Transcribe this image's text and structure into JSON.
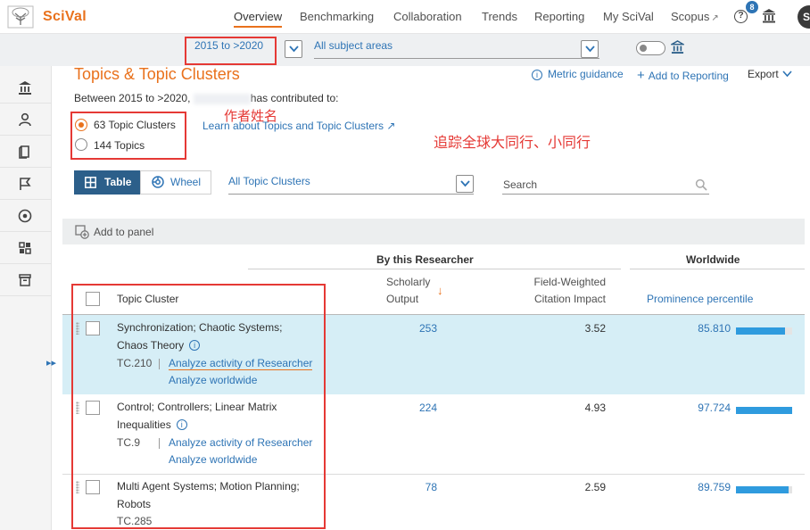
{
  "nav": {
    "brand": "SciVal",
    "items": [
      {
        "label": "Overview",
        "active": true
      },
      {
        "label": "Benchmarking"
      },
      {
        "label": "Collaboration"
      },
      {
        "label": "Trends"
      },
      {
        "label": "Reporting"
      },
      {
        "label": "My SciVal"
      },
      {
        "label": "Scopus",
        "external": true
      }
    ],
    "help_label": "?",
    "notification_count": "8",
    "avatar_initials": "SI"
  },
  "filters": {
    "date_range": "2015 to >2020",
    "subject_areas": "All subject areas"
  },
  "sidebar": {
    "items": [
      "institution-icon",
      "person-icon",
      "book-icon",
      "flag-icon",
      "target-icon",
      "grid-icon",
      "archive-icon"
    ],
    "expand_label": "▸▸"
  },
  "page": {
    "title": "Topics & Topic Clusters",
    "metric_guidance": "Metric guidance",
    "add_to_reporting": "Add to Reporting",
    "export": "Export",
    "intro_prefix": "Between 2015 to >2020, ",
    "intro_suffix": "has contributed to:",
    "radio_clusters": "63 Topic Clusters",
    "radio_topics": "144 Topics",
    "learn_link": "Learn about Topics and Topic Clusters ↗"
  },
  "annotations": {
    "author_name": "作者姓名",
    "tracking": "追踪全球大同行、小同行"
  },
  "view": {
    "table_label": "Table",
    "wheel_label": "Wheel",
    "cluster_filter": "All Topic Clusters",
    "search_placeholder": "Search"
  },
  "panel": {
    "add_label": "Add to panel"
  },
  "table": {
    "group_researcher": "By this Researcher",
    "group_worldwide": "Worldwide",
    "col_topic": "Topic Cluster",
    "col_output_1": "Scholarly",
    "col_output_2": "Output",
    "col_fwci_1": "Field-Weighted",
    "col_fwci_2": "Citation Impact",
    "col_prominence": "Prominence percentile",
    "sort_indicator": "↓",
    "rows": [
      {
        "name_1": "Synchronization; Chaotic Systems;",
        "name_2": "Chaos Theory",
        "id": "TC.210",
        "link_researcher": "Analyze activity of Researcher",
        "link_worldwide": "Analyze worldwide",
        "output": "253",
        "fwci": "3.52",
        "prominence": "85.810",
        "prominence_fraction": 0.87
      },
      {
        "name_1": "Control; Controllers; Linear Matrix",
        "name_2": "Inequalities",
        "id": "TC.9",
        "link_researcher": "Analyze activity of Researcher",
        "link_worldwide": "Analyze worldwide",
        "output": "224",
        "fwci": "4.93",
        "prominence": "97.724",
        "prominence_fraction": 1.0
      },
      {
        "name_1": "Multi Agent Systems; Motion Planning;",
        "name_2": "Robots",
        "id": "TC.285",
        "output": "78",
        "fwci": "2.59",
        "prominence": "89.759",
        "prominence_fraction": 0.93
      }
    ]
  }
}
